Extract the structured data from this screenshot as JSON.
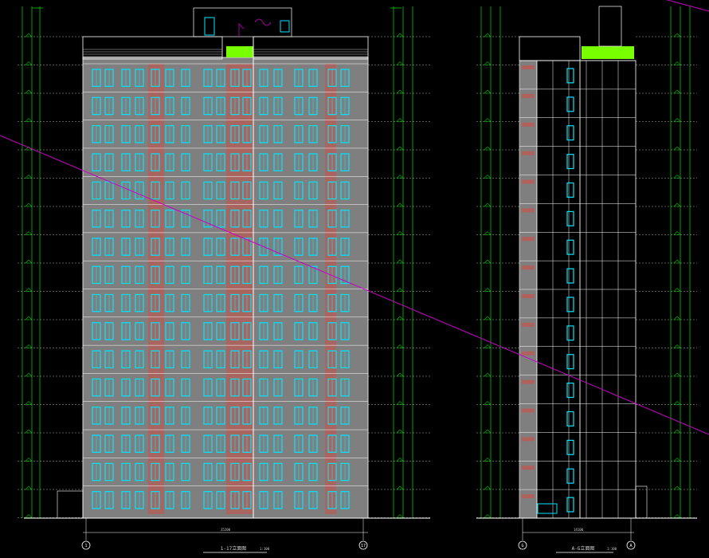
{
  "drawing": {
    "left_title": "1-17立面图",
    "left_title_scale": "1:100",
    "right_title": "A-G立面图",
    "right_title_scale": "1:100"
  },
  "left_view": {
    "floors": 16,
    "grid_left": "1",
    "grid_right": "17",
    "total_width_dim": "35200"
  },
  "right_view": {
    "floors": 16,
    "grid_left": "G",
    "grid_right": "A",
    "total_width_dim": "14100"
  },
  "colors": {
    "background": "#000000",
    "facade": "#7f7f7f",
    "window": "#00e5ff",
    "brick": "#b0615b",
    "dimension": "#00c800",
    "roof_band": "#78ff00",
    "section_line": "#c800c8",
    "linework": "#ffffff"
  }
}
